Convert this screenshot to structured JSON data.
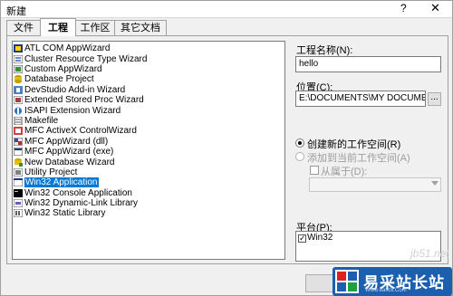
{
  "window": {
    "title": "新建",
    "help": "?",
    "close": "✕"
  },
  "tabs": [
    {
      "label": "文件"
    },
    {
      "label": "工程"
    },
    {
      "label": "工作区"
    },
    {
      "label": "其它文档"
    }
  ],
  "projects": [
    {
      "label": "ATL COM AppWizard",
      "icon": "atl-icon"
    },
    {
      "label": "Cluster Resource Type Wizard",
      "icon": "cluster-icon"
    },
    {
      "label": "Custom AppWizard",
      "icon": "custom-wizard-icon"
    },
    {
      "label": "Database Project",
      "icon": "database-icon"
    },
    {
      "label": "DevStudio Add-in Wizard",
      "icon": "addin-icon"
    },
    {
      "label": "Extended Stored Proc Wizard",
      "icon": "stored-proc-icon"
    },
    {
      "label": "ISAPI Extension Wizard",
      "icon": "isapi-icon"
    },
    {
      "label": "Makefile",
      "icon": "makefile-icon"
    },
    {
      "label": "MFC ActiveX ControlWizard",
      "icon": "activex-icon"
    },
    {
      "label": "MFC AppWizard (dll)",
      "icon": "mfc-dll-icon"
    },
    {
      "label": "MFC AppWizard (exe)",
      "icon": "mfc-exe-icon"
    },
    {
      "label": "New Database Wizard",
      "icon": "new-database-icon"
    },
    {
      "label": "Utility Project",
      "icon": "utility-icon"
    },
    {
      "label": "Win32 Application",
      "icon": "win32-app-icon",
      "selected": true
    },
    {
      "label": "Win32 Console Application",
      "icon": "console-icon"
    },
    {
      "label": "Win32 Dynamic-Link Library",
      "icon": "dll-icon"
    },
    {
      "label": "Win32 Static Library",
      "icon": "static-lib-icon"
    }
  ],
  "form": {
    "project_name_label": "工程名称(N):",
    "project_name_value": "hello",
    "location_label": "位置(C):",
    "location_value": "E:\\DOCUMENTS\\MY DOCUMENT",
    "browse_label": "...",
    "create_new_workspace_label": "创建新的工作空间(R)",
    "add_to_current_workspace_label": "添加到当前工作空间(A)",
    "dependency_label": "从属于(D):",
    "platform_label": "平台(P):",
    "platforms": [
      {
        "label": "Win32",
        "checked": true
      }
    ]
  },
  "footer": {
    "watermark": "jb51.net",
    "logo_text": "易采站长站",
    "logo_sub": "Www.easck.Com"
  },
  "colors": {
    "selection": "#0078d7",
    "logo_bg": "#1b5fae"
  }
}
